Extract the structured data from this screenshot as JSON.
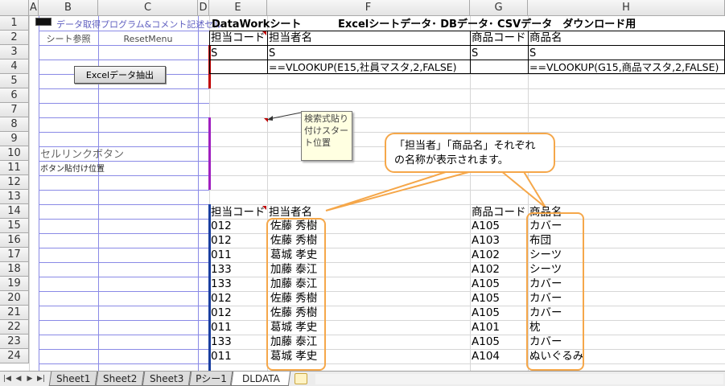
{
  "columns": [
    "A",
    "B",
    "C",
    "D",
    "E",
    "F",
    "G",
    "H"
  ],
  "rows": [
    "1",
    "2",
    "3",
    "4",
    "5",
    "6",
    "7",
    "8",
    "9",
    "10",
    "11",
    "12",
    "13",
    "14",
    "15",
    "16",
    "17",
    "18",
    "19",
    "20",
    "21",
    "22",
    "23",
    "24"
  ],
  "row1": {
    "b_label": "データ取得プログラム&コメント記述セル",
    "sheet_title": "DataWorkシート",
    "sheet_subtitle": "Excelシートデータ･ DBデータ･ CSVデータ　ダウンロード用"
  },
  "row2": {
    "b_label": "シート参照",
    "c_label": "ResetMenu",
    "e": "担当コード",
    "f": "担当者名",
    "g": "商品コード",
    "h": "商品名"
  },
  "row3": {
    "e": "S",
    "f": "S",
    "g": "S",
    "h": "S"
  },
  "row4": {
    "f": "==VLOOKUP(E15,社員マスタ,2,FALSE)",
    "h": "==VLOOKUP(G15,商品マスタ,2,FALSE)"
  },
  "buttons": {
    "extract": "Excelデータ抽出"
  },
  "labels": {
    "cell_link_button": "セルリンクボタン",
    "button_paste_pos": "ボタン貼付け位置"
  },
  "comment": "検索式貼り付けスタート位置",
  "callout": "「担当者」「商品名」それぞれの名称が表示されます。",
  "table_header": {
    "e": "担当コード",
    "f": "担当者名",
    "g": "商品コード",
    "h": "商品名"
  },
  "table_rows": [
    {
      "e": "012",
      "f": "佐藤 秀樹",
      "g": "A105",
      "h": "カバー"
    },
    {
      "e": "012",
      "f": "佐藤 秀樹",
      "g": "A103",
      "h": "布団"
    },
    {
      "e": "011",
      "f": "葛城 孝史",
      "g": "A102",
      "h": "シーツ"
    },
    {
      "e": "133",
      "f": "加藤 泰江",
      "g": "A102",
      "h": "シーツ"
    },
    {
      "e": "133",
      "f": "加藤 泰江",
      "g": "A105",
      "h": "カバー"
    },
    {
      "e": "012",
      "f": "佐藤 秀樹",
      "g": "A105",
      "h": "カバー"
    },
    {
      "e": "012",
      "f": "佐藤 秀樹",
      "g": "A105",
      "h": "カバー"
    },
    {
      "e": "011",
      "f": "葛城 孝史",
      "g": "A101",
      "h": "枕"
    },
    {
      "e": "133",
      "f": "加藤 泰江",
      "g": "A105",
      "h": "カバー"
    },
    {
      "e": "011",
      "f": "葛城 孝史",
      "g": "A104",
      "h": "ぬいぐるみ"
    }
  ],
  "tabs": [
    "Sheet1",
    "Sheet2",
    "Sheet3",
    "Pシー1",
    "DLDATA"
  ],
  "active_tab": "DLDATA",
  "colors": {
    "accent_orange": "#f5a74a",
    "blue_grid": "#8a8ae6",
    "red_marker": "#c00000",
    "purple_bar": "#a020c0",
    "dark_blue_bar": "#1a3fa0",
    "comment_bg": "#ffffe1"
  },
  "icons": [
    "first-sheet-icon",
    "prev-sheet-icon",
    "next-sheet-icon",
    "last-sheet-icon",
    "new-sheet-icon"
  ]
}
